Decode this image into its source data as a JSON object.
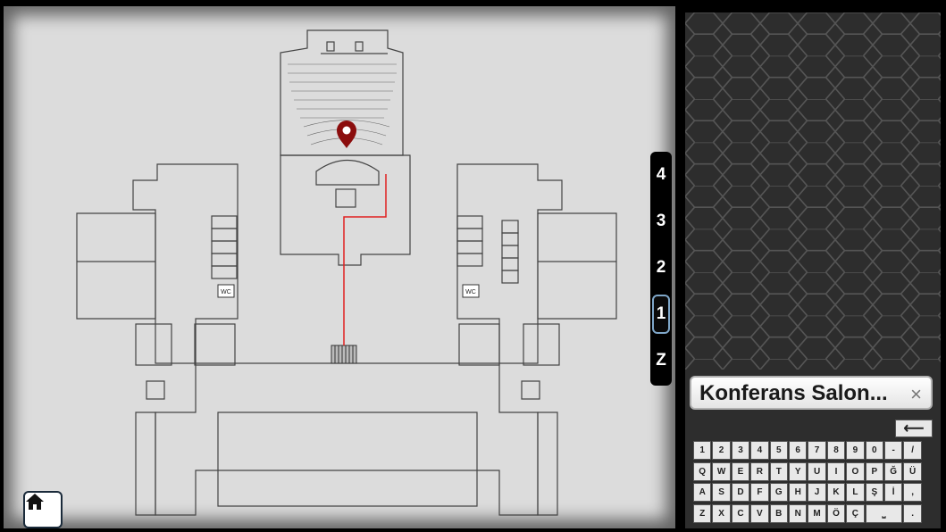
{
  "map": {
    "wc_labels": [
      "WC",
      "WC"
    ],
    "route_color": "#e02020",
    "marker_color": "#8b0d0d"
  },
  "home_button": {
    "icon": "home-icon"
  },
  "floors": [
    "4",
    "3",
    "2",
    "1",
    "Z"
  ],
  "active_floor": "1",
  "search": {
    "value": "Konferans Salon...",
    "clear_symbol": "×"
  },
  "keyboard": {
    "backspace": "⟵",
    "rows": [
      [
        "1",
        "2",
        "3",
        "4",
        "5",
        "6",
        "7",
        "8",
        "9",
        "0",
        "-",
        "/"
      ],
      [
        "Q",
        "W",
        "E",
        "R",
        "T",
        "Y",
        "U",
        "I",
        "O",
        "P",
        "Ğ",
        "Ü"
      ],
      [
        "A",
        "S",
        "D",
        "F",
        "G",
        "H",
        "J",
        "K",
        "L",
        "Ş",
        "İ",
        ","
      ],
      [
        "Z",
        "X",
        "C",
        "V",
        "B",
        "N",
        "M",
        "Ö",
        "Ç",
        "⎵",
        "."
      ]
    ]
  },
  "colors": {
    "map_background": "#dcdcdc",
    "panel_background": "#2d2d2d",
    "active_floor_border": "#7fa7c9"
  }
}
